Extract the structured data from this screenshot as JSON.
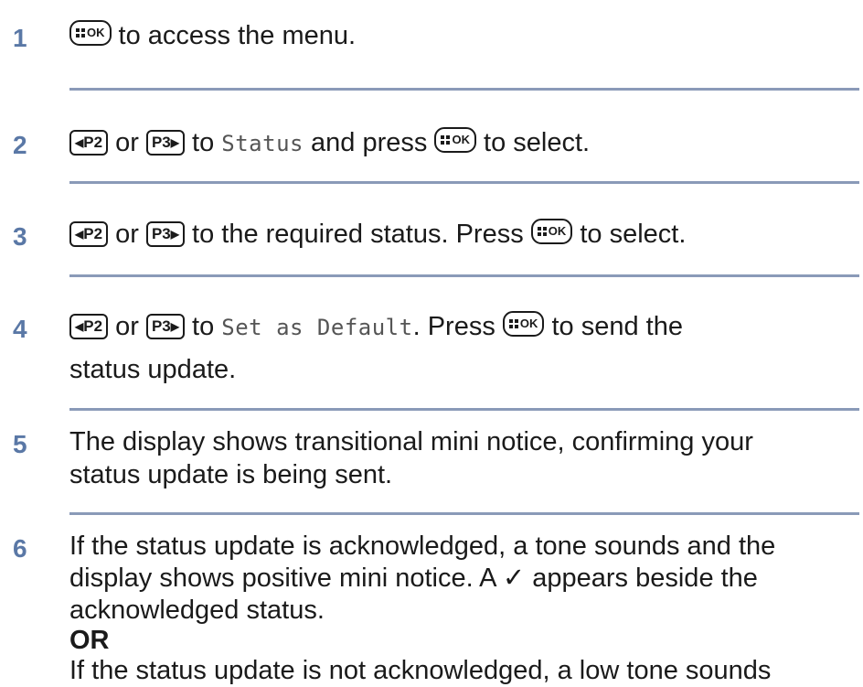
{
  "keys": {
    "ok": "OK",
    "p2": "P2",
    "p3": "P3",
    "left_arrow": "◀",
    "right_arrow": "▶"
  },
  "steps": [
    {
      "number": "1",
      "after_ok": " to access the menu."
    },
    {
      "number": "2",
      "or": " or ",
      "to": " to ",
      "display_text": "Status",
      "after_display": " and press ",
      "after_ok": " to select."
    },
    {
      "number": "3",
      "or": " or ",
      "after_p3": " to the required status. Press ",
      "after_ok": " to select."
    },
    {
      "number": "4",
      "or": " or ",
      "to": " to ",
      "display_text": "Set as Default",
      "after_display": ". Press ",
      "after_ok": " to send the",
      "line2": "status update."
    },
    {
      "number": "5",
      "line1": "The display shows transitional mini notice, confirming your",
      "line2": "status update is being sent."
    },
    {
      "number": "6",
      "line1": "If the status update is acknowledged, a tone sounds and the",
      "line2": "display shows positive mini notice. A ✓ appears beside the",
      "line3": "acknowledged status.",
      "or_label": "OR",
      "line5": "If the status update is not acknowledged, a low tone sounds"
    }
  ],
  "colors": {
    "step_number": "#5a78a6",
    "rule": "#8a9ab8",
    "body_text": "#1a1a1a",
    "display_text": "#555555"
  }
}
